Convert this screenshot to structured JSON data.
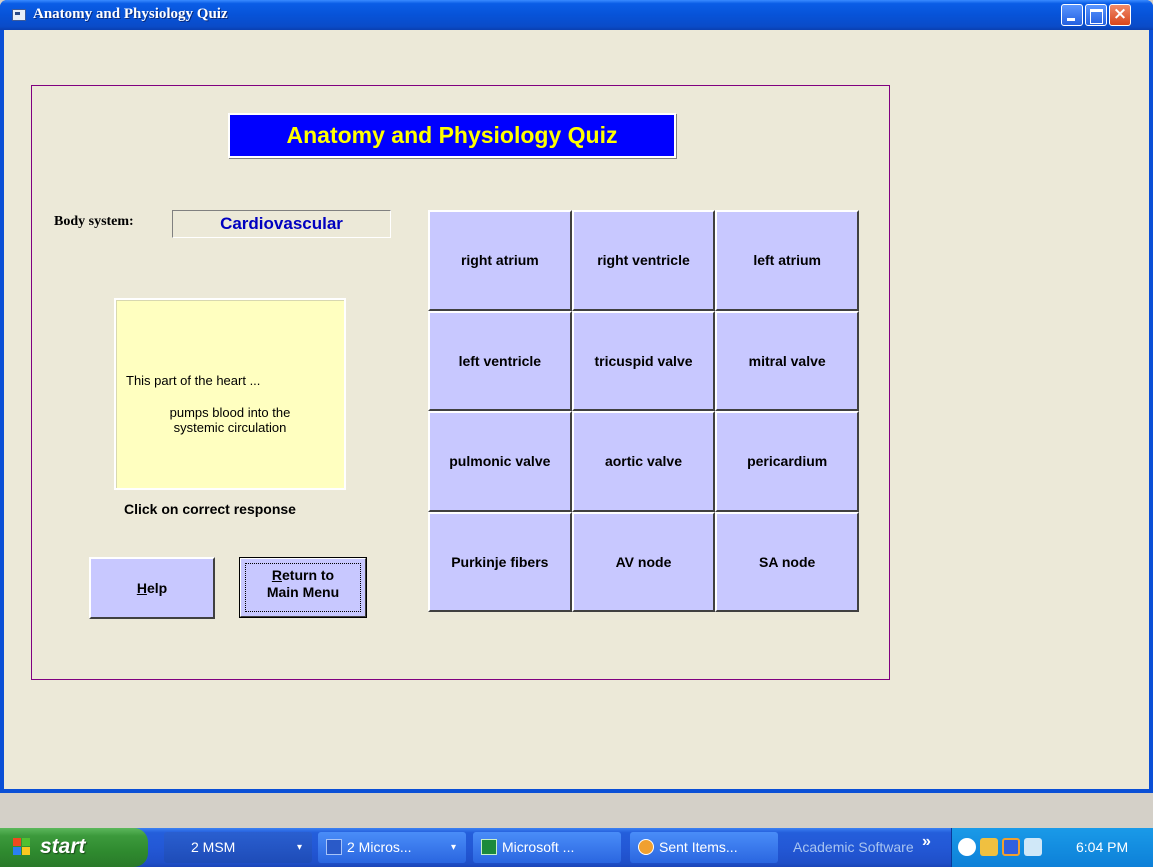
{
  "window": {
    "title": "Anatomy and Physiology Quiz"
  },
  "quiz": {
    "title": "Anatomy and Physiology Quiz",
    "body_system_label": "Body system:",
    "body_system_value": "Cardiovascular",
    "question_line1": "This part of the heart ...",
    "question_line2": "pumps blood into the systemic circulation",
    "instruction": "Click on correct response",
    "help_label": "elp",
    "help_mnemonic": "H",
    "return_mnemonic": "R",
    "return_line1_rest": "eturn to",
    "return_line2": "Main Menu",
    "answers": [
      "right atrium",
      "right ventricle",
      "left atrium",
      "left ventricle",
      "tricuspid valve",
      "mitral valve",
      "pulmonic valve",
      "aortic valve",
      "pericardium",
      "Purkinje fibers",
      "AV node",
      "SA node"
    ]
  },
  "taskbar": {
    "start_label": "start",
    "tasks": [
      {
        "label": "2 MSM",
        "icon": "folder-icon"
      },
      {
        "label": "2 Micros...",
        "icon": "word-icon"
      },
      {
        "label": "Microsoft ...",
        "icon": "excel-icon"
      },
      {
        "label": "Sent Items...",
        "icon": "outlook-icon"
      }
    ],
    "toolbar_label": "Academic Software",
    "chevron": "»",
    "clock": "6:04 PM"
  },
  "colors": {
    "title_bg": "#0000ff",
    "title_text": "#ffff00",
    "button_face": "#c8c8ff",
    "question_bg": "#ffffc0",
    "frame_border": "#800080",
    "body_system_text": "#0000c0"
  }
}
